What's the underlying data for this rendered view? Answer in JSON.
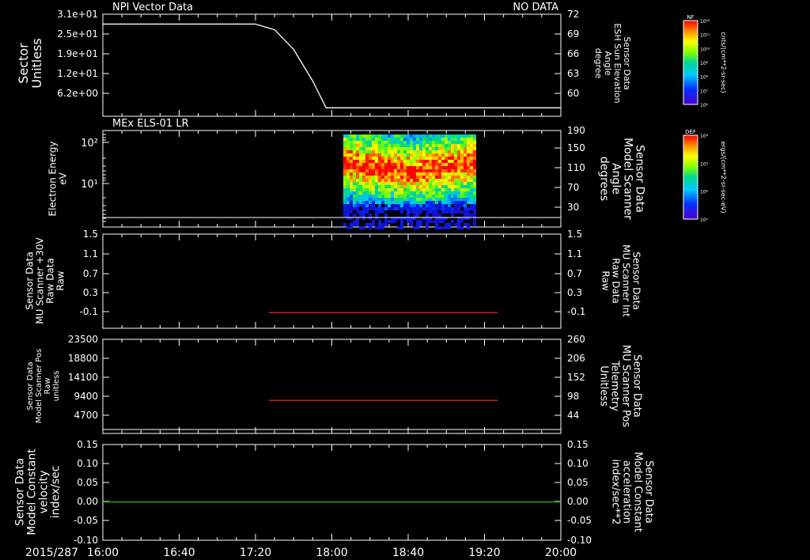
{
  "date_label": "2015/287",
  "time_ticks": [
    "16:00",
    "16:40",
    "17:20",
    "18:00",
    "18:40",
    "19:20",
    "20:00"
  ],
  "chart_data": [
    {
      "type": "line",
      "title": "NPI Vector Data",
      "status": "NO DATA",
      "ylabel": [
        "Sector",
        "Unitless"
      ],
      "yticks": [
        "3.1e+01",
        "2.5e+01",
        "1.9e+01",
        "1.2e+01",
        "6.2e+00"
      ],
      "y2label": [
        "Sensor Data",
        "ESH Sun Elevation",
        "Angle",
        "degree"
      ],
      "y2ticks": [
        "72",
        "69",
        "66",
        "63",
        "60"
      ],
      "y2lim": [
        57.5,
        72
      ],
      "color": "#ffffff",
      "series": [
        {
          "x": [
            "16:00",
            "17:20",
            "17:30",
            "17:40",
            "17:50",
            "17:57",
            "20:00"
          ],
          "values": [
            70.6,
            70.6,
            69.8,
            67.0,
            62.5,
            58.7,
            58.7
          ]
        }
      ]
    },
    {
      "type": "heatmap",
      "title": "MEx ELS-01 LR",
      "ylabel": [
        "Electron Energy",
        "eV"
      ],
      "yticks": [
        "10²",
        "10¹"
      ],
      "y2label": [
        "Sensor Data",
        "Model Scanner",
        "Angle",
        "degrees"
      ],
      "y2ticks": [
        "190",
        "150",
        "110",
        "70",
        "30"
      ],
      "x_range": [
        "18:06",
        "19:20"
      ],
      "baseline_y2": 10,
      "colorbar": {
        "label": "DEF",
        "units": "ergs/(cm**2-sr-sec-eV)",
        "ticks": [
          "10⁴",
          "10³",
          "10²",
          "10¹"
        ]
      }
    },
    {
      "type": "line",
      "ylabel": [
        "Sensor Data",
        "MU Scanner +30V",
        "Raw Data",
        "Raw"
      ],
      "yticks": [
        "1.5",
        "1.1",
        "0.7",
        "0.3",
        "-0.1"
      ],
      "ylim": [
        -0.3,
        1.5
      ],
      "y2label": [
        "Sensor Data",
        "MU Scanner Int",
        "Raw Data",
        "Raw"
      ],
      "y2ticks": [
        "1.5",
        "1.1",
        "0.7",
        "0.3",
        "-0.1"
      ],
      "color": "#e02020",
      "series": [
        {
          "x": [
            "17:27",
            "19:27"
          ],
          "values": [
            0.0,
            0.0
          ]
        }
      ]
    },
    {
      "type": "line",
      "ylabel": [
        "Sensor Data",
        "Model Scanner Pos",
        "Raw",
        "unitless"
      ],
      "yticks": [
        "23500",
        "18800",
        "14100",
        "9400",
        "4700"
      ],
      "y2label": [
        "Sensor Data",
        "MU Scanner Pos",
        "Telemetry",
        "Unitless"
      ],
      "y2ticks": [
        "260",
        "206",
        "152",
        "98",
        "44"
      ],
      "ylim": [
        0,
        23500
      ],
      "color": "#e02020",
      "series": [
        {
          "x": [
            "17:27",
            "19:27"
          ],
          "values": [
            8000,
            8000
          ]
        }
      ]
    },
    {
      "type": "line",
      "ylabel": [
        "Sensor Data",
        "Model Constant",
        "velocity",
        "index/sec"
      ],
      "yticks": [
        "0.15",
        "0.10",
        "0.05",
        "0.00",
        "-0.05",
        "-0.10"
      ],
      "y2label": [
        "Sensor Data",
        "Model Constant",
        "acceleration",
        "index/sec**2"
      ],
      "y2ticks": [
        "0.15",
        "0.10",
        "0.05",
        "0.00",
        "-0.05",
        "-0.10"
      ],
      "ylim": [
        -0.1,
        0.15
      ],
      "color": "#20c020",
      "series": [
        {
          "x": [
            "16:00",
            "20:00"
          ],
          "values": [
            0.0,
            0.0
          ]
        }
      ]
    }
  ],
  "top_colorbar": {
    "label": "NF",
    "units": "cnts/(cm**2-sr-sec)",
    "ticks": [
      "10¹²",
      "10¹¹",
      "10¹⁰",
      "10⁹",
      "10⁸",
      "10⁷",
      "10⁶"
    ]
  }
}
